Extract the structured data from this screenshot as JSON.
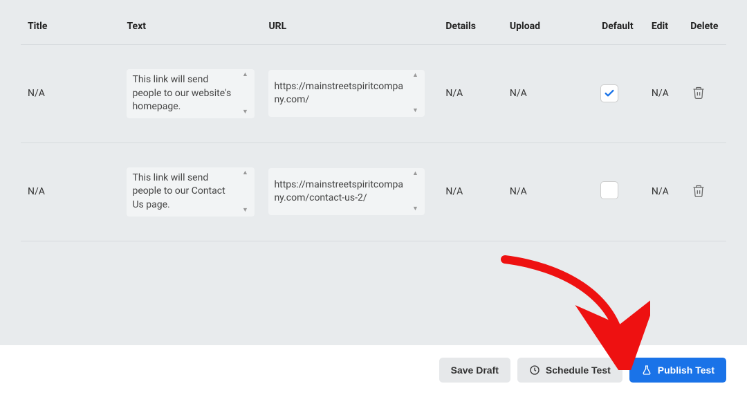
{
  "table": {
    "headers": {
      "title": "Title",
      "text": "Text",
      "url": "URL",
      "details": "Details",
      "upload": "Upload",
      "default": "Default",
      "edit": "Edit",
      "delete": "Delete"
    },
    "rows": [
      {
        "title": "N/A",
        "text": "This link will send people to our website's homepage.",
        "url": "https://mainstreetspiritcompany.com/",
        "details": "N/A",
        "upload": "N/A",
        "default_checked": true,
        "edit": "N/A"
      },
      {
        "title": "N/A",
        "text": "This link will send people to our Contact Us page.",
        "url": "https://mainstreetspiritcompany.com/contact-us-2/",
        "details": "N/A",
        "upload": "N/A",
        "default_checked": false,
        "edit": "N/A"
      }
    ]
  },
  "footer": {
    "save_draft": "Save Draft",
    "schedule_test": "Schedule Test",
    "publish_test": "Publish Test"
  }
}
